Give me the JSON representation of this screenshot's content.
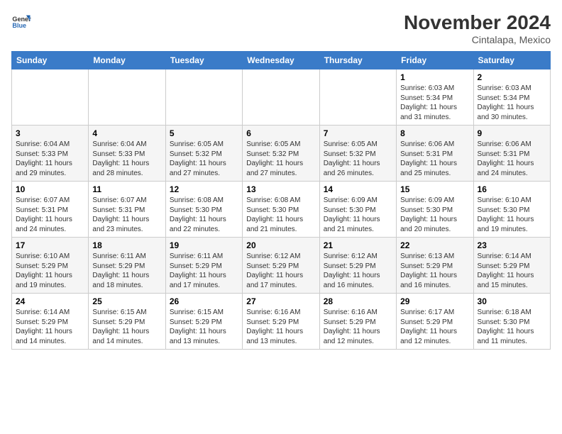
{
  "header": {
    "logo_general": "General",
    "logo_blue": "Blue",
    "month_title": "November 2024",
    "location": "Cintalapa, Mexico"
  },
  "days_of_week": [
    "Sunday",
    "Monday",
    "Tuesday",
    "Wednesday",
    "Thursday",
    "Friday",
    "Saturday"
  ],
  "weeks": [
    [
      {
        "day": "",
        "info": ""
      },
      {
        "day": "",
        "info": ""
      },
      {
        "day": "",
        "info": ""
      },
      {
        "day": "",
        "info": ""
      },
      {
        "day": "",
        "info": ""
      },
      {
        "day": "1",
        "info": "Sunrise: 6:03 AM\nSunset: 5:34 PM\nDaylight: 11 hours and 31 minutes."
      },
      {
        "day": "2",
        "info": "Sunrise: 6:03 AM\nSunset: 5:34 PM\nDaylight: 11 hours and 30 minutes."
      }
    ],
    [
      {
        "day": "3",
        "info": "Sunrise: 6:04 AM\nSunset: 5:33 PM\nDaylight: 11 hours and 29 minutes."
      },
      {
        "day": "4",
        "info": "Sunrise: 6:04 AM\nSunset: 5:33 PM\nDaylight: 11 hours and 28 minutes."
      },
      {
        "day": "5",
        "info": "Sunrise: 6:05 AM\nSunset: 5:32 PM\nDaylight: 11 hours and 27 minutes."
      },
      {
        "day": "6",
        "info": "Sunrise: 6:05 AM\nSunset: 5:32 PM\nDaylight: 11 hours and 27 minutes."
      },
      {
        "day": "7",
        "info": "Sunrise: 6:05 AM\nSunset: 5:32 PM\nDaylight: 11 hours and 26 minutes."
      },
      {
        "day": "8",
        "info": "Sunrise: 6:06 AM\nSunset: 5:31 PM\nDaylight: 11 hours and 25 minutes."
      },
      {
        "day": "9",
        "info": "Sunrise: 6:06 AM\nSunset: 5:31 PM\nDaylight: 11 hours and 24 minutes."
      }
    ],
    [
      {
        "day": "10",
        "info": "Sunrise: 6:07 AM\nSunset: 5:31 PM\nDaylight: 11 hours and 24 minutes."
      },
      {
        "day": "11",
        "info": "Sunrise: 6:07 AM\nSunset: 5:31 PM\nDaylight: 11 hours and 23 minutes."
      },
      {
        "day": "12",
        "info": "Sunrise: 6:08 AM\nSunset: 5:30 PM\nDaylight: 11 hours and 22 minutes."
      },
      {
        "day": "13",
        "info": "Sunrise: 6:08 AM\nSunset: 5:30 PM\nDaylight: 11 hours and 21 minutes."
      },
      {
        "day": "14",
        "info": "Sunrise: 6:09 AM\nSunset: 5:30 PM\nDaylight: 11 hours and 21 minutes."
      },
      {
        "day": "15",
        "info": "Sunrise: 6:09 AM\nSunset: 5:30 PM\nDaylight: 11 hours and 20 minutes."
      },
      {
        "day": "16",
        "info": "Sunrise: 6:10 AM\nSunset: 5:30 PM\nDaylight: 11 hours and 19 minutes."
      }
    ],
    [
      {
        "day": "17",
        "info": "Sunrise: 6:10 AM\nSunset: 5:29 PM\nDaylight: 11 hours and 19 minutes."
      },
      {
        "day": "18",
        "info": "Sunrise: 6:11 AM\nSunset: 5:29 PM\nDaylight: 11 hours and 18 minutes."
      },
      {
        "day": "19",
        "info": "Sunrise: 6:11 AM\nSunset: 5:29 PM\nDaylight: 11 hours and 17 minutes."
      },
      {
        "day": "20",
        "info": "Sunrise: 6:12 AM\nSunset: 5:29 PM\nDaylight: 11 hours and 17 minutes."
      },
      {
        "day": "21",
        "info": "Sunrise: 6:12 AM\nSunset: 5:29 PM\nDaylight: 11 hours and 16 minutes."
      },
      {
        "day": "22",
        "info": "Sunrise: 6:13 AM\nSunset: 5:29 PM\nDaylight: 11 hours and 16 minutes."
      },
      {
        "day": "23",
        "info": "Sunrise: 6:14 AM\nSunset: 5:29 PM\nDaylight: 11 hours and 15 minutes."
      }
    ],
    [
      {
        "day": "24",
        "info": "Sunrise: 6:14 AM\nSunset: 5:29 PM\nDaylight: 11 hours and 14 minutes."
      },
      {
        "day": "25",
        "info": "Sunrise: 6:15 AM\nSunset: 5:29 PM\nDaylight: 11 hours and 14 minutes."
      },
      {
        "day": "26",
        "info": "Sunrise: 6:15 AM\nSunset: 5:29 PM\nDaylight: 11 hours and 13 minutes."
      },
      {
        "day": "27",
        "info": "Sunrise: 6:16 AM\nSunset: 5:29 PM\nDaylight: 11 hours and 13 minutes."
      },
      {
        "day": "28",
        "info": "Sunrise: 6:16 AM\nSunset: 5:29 PM\nDaylight: 11 hours and 12 minutes."
      },
      {
        "day": "29",
        "info": "Sunrise: 6:17 AM\nSunset: 5:29 PM\nDaylight: 11 hours and 12 minutes."
      },
      {
        "day": "30",
        "info": "Sunrise: 6:18 AM\nSunset: 5:30 PM\nDaylight: 11 hours and 11 minutes."
      }
    ]
  ]
}
